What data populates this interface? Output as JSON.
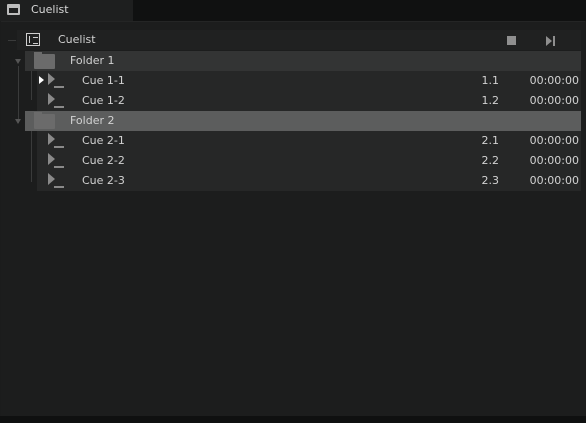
{
  "tab": {
    "title": "Cuelist",
    "icon": "folder-icon"
  },
  "cuelist": {
    "title": "Cuelist",
    "icon": "list-icon",
    "stop_icon": "stop-icon",
    "next_icon": "skip-next-icon"
  },
  "folders": [
    {
      "label": "Folder 1",
      "cues": [
        {
          "label": "Cue 1-1",
          "number": "1.1",
          "time": "00:00:00",
          "active": true
        },
        {
          "label": "Cue 1-2",
          "number": "1.2",
          "time": "00:00:00",
          "active": false
        }
      ]
    },
    {
      "label": "Folder 2",
      "selected": true,
      "cues": [
        {
          "label": "Cue 2-1",
          "number": "2.1",
          "time": "00:00:00",
          "active": false
        },
        {
          "label": "Cue 2-2",
          "number": "2.2",
          "time": "00:00:00",
          "active": false
        },
        {
          "label": "Cue 2-3",
          "number": "2.3",
          "time": "00:00:00",
          "active": false
        }
      ]
    }
  ]
}
